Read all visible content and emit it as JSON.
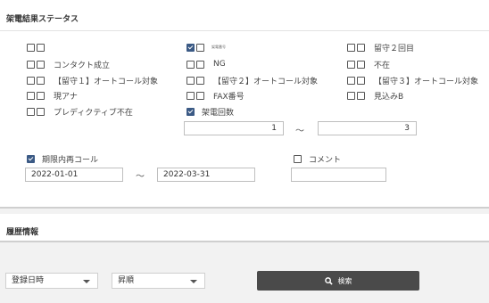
{
  "status_section": {
    "title": "架電結果ステータス",
    "items": [
      {
        "label": "",
        "checked": false
      },
      {
        "label": "コンタクト成立",
        "checked": false
      },
      {
        "label": "【留守１】オートコール対象",
        "checked": false
      },
      {
        "label": "現アナ",
        "checked": false
      },
      {
        "label": "プレディクティブ不在",
        "checked": false
      },
      {
        "label": "架電番号",
        "checked": true
      },
      {
        "label": "NG",
        "checked": false
      },
      {
        "label": "【留守２】オートコール対象",
        "checked": false
      },
      {
        "label": "FAX番号",
        "checked": false
      },
      {
        "label": "留守２回目",
        "checked": false
      },
      {
        "label": "不在",
        "checked": false
      },
      {
        "label": "【留守３】オートコール対象",
        "checked": false
      },
      {
        "label": "見込みB",
        "checked": false
      }
    ],
    "call_count": {
      "label": "架電回数",
      "checked": true,
      "from": "1",
      "to": "3",
      "separator": "〜"
    },
    "deadline_recall": {
      "label": "期限内再コール",
      "checked": true,
      "from": "2022-01-01",
      "to": "2022-03-31",
      "separator": "〜"
    },
    "comment": {
      "label": "コメント",
      "checked": false,
      "value": ""
    }
  },
  "history_section": {
    "title": "履歴情報"
  },
  "footer": {
    "sort_field": "登録日時",
    "sort_order": "昇順",
    "search_label": "検索"
  }
}
